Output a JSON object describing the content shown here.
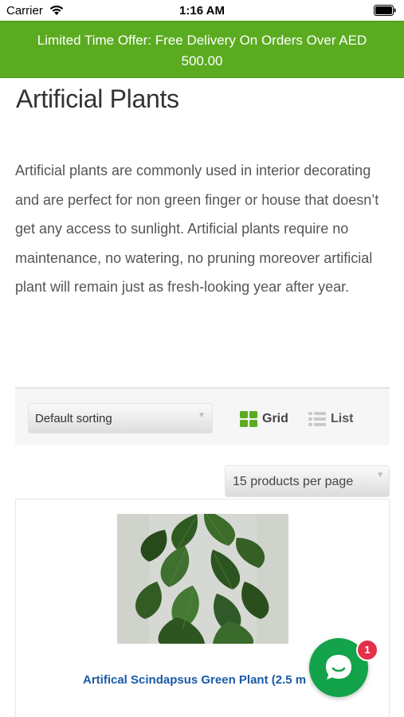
{
  "status_bar": {
    "carrier": "Carrier",
    "time": "1:16 AM",
    "wifi_icon": "wifi-icon",
    "battery_icon": "battery-icon"
  },
  "promo": {
    "text": "Limited Time Offer: Free Delivery On Orders Over AED 500.00",
    "background_color": "#5bab21"
  },
  "page": {
    "title": "Artificial Plants",
    "description": "Artificial plants are commonly used in interior decorating and are perfect for non green finger or house that doesn’t get any access to sunlight. Artificial plants require no maintenance, no watering, no pruning moreover artificial plant will remain just as fresh-looking year after year."
  },
  "toolbar": {
    "sort_selected": "Default sorting",
    "grid_label": "Grid",
    "list_label": "List",
    "grid_icon": "grid-icon",
    "list_icon": "list-icon",
    "grid_active_color": "#5bab21"
  },
  "per_page": {
    "selected": "15 products per page"
  },
  "products": [
    {
      "name": "Artifical Scindapsus Green Plant (2.5 m",
      "link_color": "#1a5aa6"
    }
  ],
  "chat": {
    "icon": "chat-bubble-icon",
    "badge_count": "1",
    "button_color": "#13a34a",
    "badge_color": "#e5304a"
  }
}
